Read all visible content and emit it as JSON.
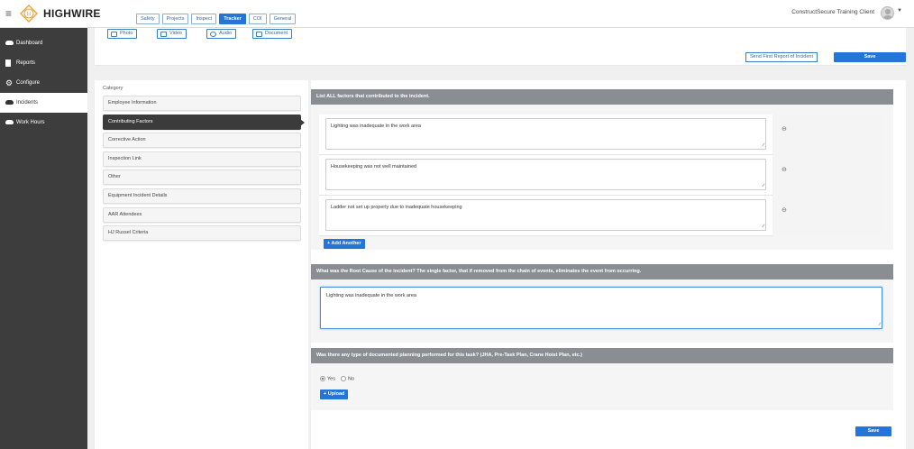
{
  "app": {
    "brand": "HIGHWIRE",
    "brand_mark": "H"
  },
  "nav": {
    "tabs": [
      {
        "label": "Safety",
        "active": false
      },
      {
        "label": "Projects",
        "active": false
      },
      {
        "label": "Inspect",
        "active": false
      },
      {
        "label": "Tracker",
        "active": true
      },
      {
        "label": "COI",
        "active": false
      },
      {
        "label": "General",
        "active": false
      }
    ]
  },
  "user": {
    "client_name": "ConstructSecure Training Client"
  },
  "sidebar": {
    "items": [
      {
        "label": "Dashboard",
        "icon": "cloud-icon",
        "active": false
      },
      {
        "label": "Reports",
        "icon": "document-icon",
        "active": false
      },
      {
        "label": "Configure",
        "icon": "gear-icon",
        "active": false
      },
      {
        "label": "Incidents",
        "icon": "cloud-icon",
        "active": true
      },
      {
        "label": "Work Hours",
        "icon": "cloud-icon",
        "active": false
      }
    ]
  },
  "media": {
    "photo": "Photo",
    "video": "Video",
    "audio": "Audio",
    "document": "Document"
  },
  "actions": {
    "send_report": "Send First Report of Incident",
    "save": "Save"
  },
  "category": {
    "title": "Category",
    "items": [
      {
        "label": "Employee Information",
        "active": false
      },
      {
        "label": "Contributing Factors",
        "active": true
      },
      {
        "label": "Corrective Action",
        "active": false
      },
      {
        "label": "Inspection Link",
        "active": false
      },
      {
        "label": "Other",
        "active": false
      },
      {
        "label": "Equipment Incident Details",
        "active": false
      },
      {
        "label": "AAR Attendees",
        "active": false
      },
      {
        "label": "HJ Russel Criteria",
        "active": false
      }
    ]
  },
  "factors": {
    "header": "List ALL factors that contributed to the incident.",
    "items": [
      "Lighting was inadequate in the work area",
      "Housekeeping was not well maintained",
      "Ladder not set up properly due to inadequate housekeeping"
    ],
    "add_label": "+ Add Another"
  },
  "root_cause": {
    "header": "What was the Root Cause of the incident? The single factor, that if removed from the chain of events, eliminates the event from occurring.",
    "value": "Lighting was inadequate in the work area"
  },
  "planning": {
    "header": "Was there any type of documented planning performed for this task? (JHA, Pre-Task Plan, Crane Hoist Plan, etc.)",
    "yes": "Yes",
    "no": "No",
    "selected": "Yes",
    "upload_label": "+ Upload"
  },
  "colors": {
    "primary": "#2474d9",
    "sidebar": "#3d3d3d",
    "brand_accent": "#e8a33d"
  }
}
